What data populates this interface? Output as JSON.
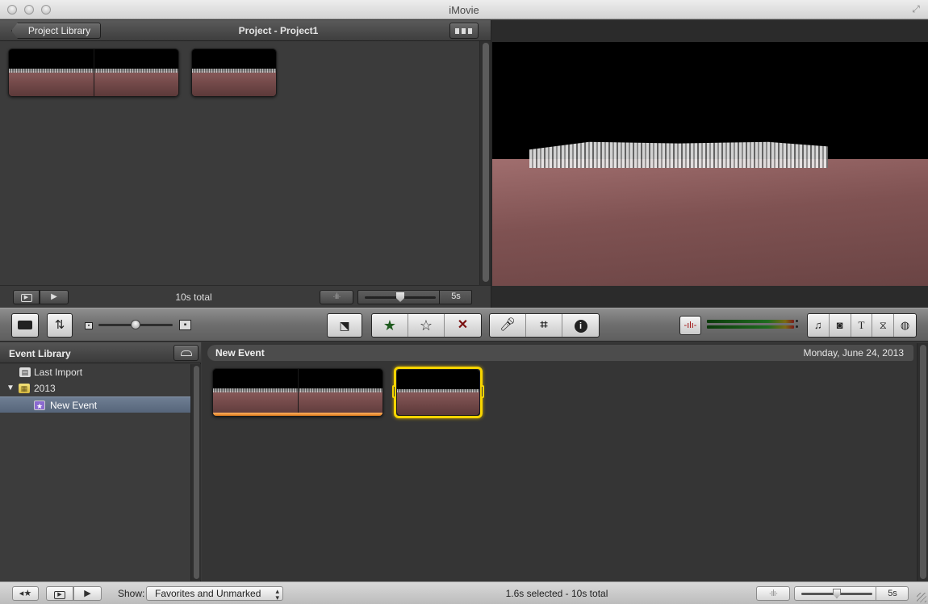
{
  "window": {
    "title": "iMovie"
  },
  "project": {
    "library_button": "Project Library",
    "title": "Project - Project1",
    "total": "10s total",
    "zoom_value": "5s"
  },
  "toolbar": {
    "icons": {
      "camera": "camera-icon",
      "swap": "swap-icon",
      "import": "import-icon",
      "favorite": "★",
      "unfavorite": "☆",
      "reject": "✕",
      "voiceover": "microphone-icon",
      "crop": "crop-icon",
      "info": "i",
      "music": "♫",
      "photo": "camera-photo-icon",
      "title": "T",
      "transition": "transition-icon",
      "map": "globe-icon"
    }
  },
  "event_library": {
    "title": "Event Library",
    "items": [
      {
        "label": "Last Import"
      },
      {
        "label": "2013"
      },
      {
        "label": "New Event"
      }
    ]
  },
  "event_browser": {
    "event_name": "New Event",
    "date": "Monday, June 24, 2013"
  },
  "bottom": {
    "show_label": "Show:",
    "show_value": "Favorites and Unmarked",
    "status": "1.6s selected - 10s total",
    "zoom_value": "5s"
  },
  "colors": {
    "selection_yellow": "#f7d400",
    "favorite_orange": "#e48a2a",
    "accent_blue": "#6f7e93"
  }
}
